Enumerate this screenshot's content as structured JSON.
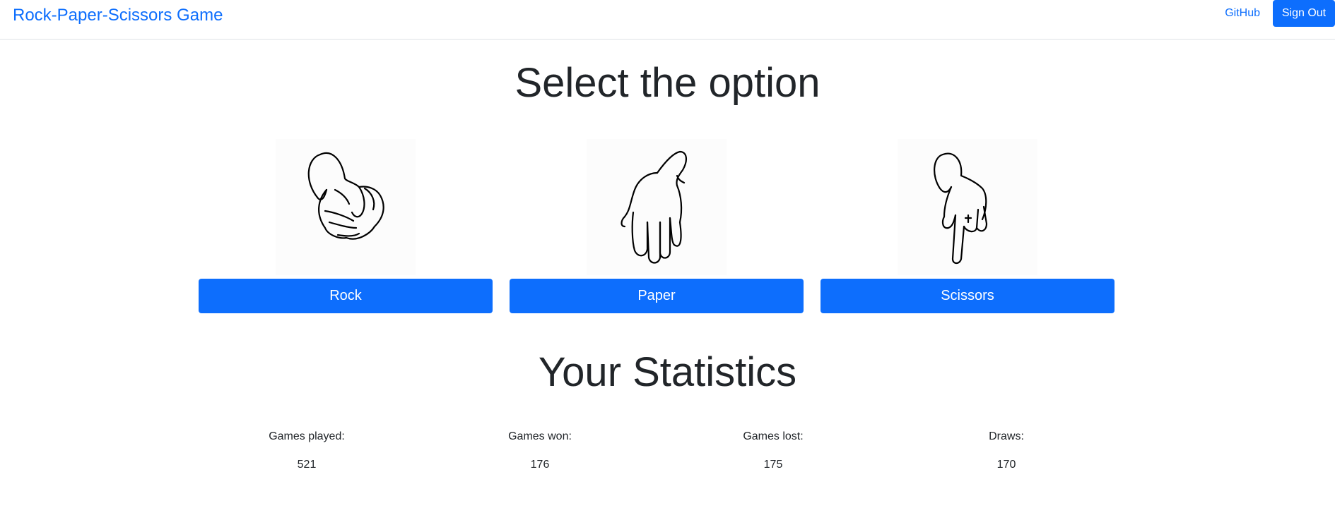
{
  "nav": {
    "brand": "Rock-Paper-Scissors Game",
    "github": "GitHub",
    "sign_out": "Sign Out"
  },
  "select_heading": "Select the option",
  "options": [
    {
      "label": "Rock",
      "icon": "rock-hand-icon"
    },
    {
      "label": "Paper",
      "icon": "paper-hand-icon"
    },
    {
      "label": "Scissors",
      "icon": "scissors-hand-icon"
    }
  ],
  "stats_heading": "Your Statistics",
  "stats": [
    {
      "label": "Games played:",
      "value": "521"
    },
    {
      "label": "Games won:",
      "value": "176"
    },
    {
      "label": "Games lost:",
      "value": "175"
    },
    {
      "label": "Draws:",
      "value": "170"
    }
  ],
  "colors": {
    "primary": "#0d6efd",
    "text": "#212529"
  }
}
